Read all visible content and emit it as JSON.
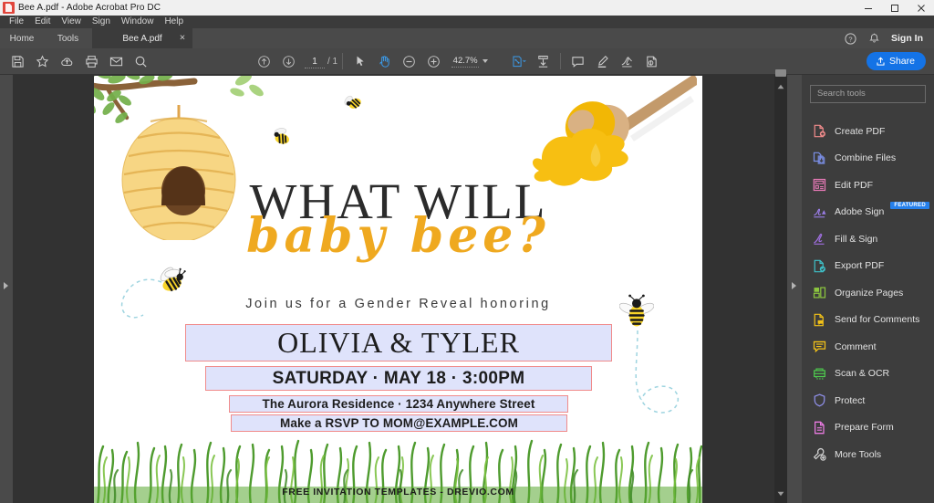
{
  "window": {
    "title": "Bee A.pdf - Adobe Acrobat Pro DC",
    "app_icon": "pdf-file-icon",
    "minimize": "minimize-icon",
    "maximize": "maximize-icon",
    "close": "close-icon"
  },
  "menubar": {
    "items": [
      {
        "label": "File"
      },
      {
        "label": "Edit"
      },
      {
        "label": "View"
      },
      {
        "label": "Sign"
      },
      {
        "label": "Window"
      },
      {
        "label": "Help"
      }
    ]
  },
  "tabs": {
    "home": "Home",
    "tools": "Tools",
    "document": "Bee A.pdf",
    "close_glyph": "×"
  },
  "account": {
    "help_icon": "help-circle-icon",
    "bell_icon": "bell-icon",
    "sign_in": "Sign In"
  },
  "toolbar": {
    "left_tools": [
      {
        "name": "save-icon",
        "title": "Save"
      },
      {
        "name": "star-icon",
        "title": "Add to favorites"
      },
      {
        "name": "cloud-upload-icon",
        "title": "Save to cloud"
      },
      {
        "name": "print-icon",
        "title": "Print file"
      },
      {
        "name": "email-icon",
        "title": "Email file"
      },
      {
        "name": "search-icon",
        "title": "Find"
      }
    ],
    "page_up_icon": "page-up-icon",
    "page_down_icon": "page-down-icon",
    "page_current": "1",
    "page_total": "/ 1",
    "select_icon": "select-cursor-icon",
    "hand_icon": "hand-tool-icon",
    "zoom_out_icon": "zoom-out-icon",
    "zoom_in_icon": "zoom-in-icon",
    "zoom_level": "42.7%",
    "right_tools": [
      {
        "name": "page-thumbnails-icon",
        "title": "Page display"
      },
      {
        "name": "fit-page-icon",
        "title": "Fit page"
      },
      {
        "name": "comment-icon",
        "title": "Add comment"
      },
      {
        "name": "highlight-icon",
        "title": "Highlight text"
      },
      {
        "name": "signature-icon",
        "title": "Sign"
      },
      {
        "name": "stamp-icon",
        "title": "Stamp"
      }
    ],
    "share_label": "Share",
    "share_icon": "share-upload-icon",
    "share_color": "#1473e6"
  },
  "rails": {
    "left_expand_icon": "expand-left-panel-icon",
    "right_expand_icon": "expand-right-panel-icon"
  },
  "scrollbar": {
    "up_icon": "scroll-up-icon",
    "down_icon": "scroll-down-icon"
  },
  "document": {
    "headline_top": "WHAT WILL",
    "headline_script": "baby bee?",
    "intro_line": "Join us for a Gender Reveal honoring",
    "fields": [
      {
        "name": "names-field",
        "value": "OLIVIA & TYLER"
      },
      {
        "name": "date-field",
        "value": "SATURDAY · MAY 18 ·  3:00PM"
      },
      {
        "name": "address-field",
        "value": "The Aurora Residence · 1234 Anywhere Street"
      },
      {
        "name": "rsvp-field",
        "value": "Make a RSVP TO MOM@EXAMPLE.COM"
      }
    ],
    "footer_credit": "FREE INVITATION TEMPLATES - DREVIO.COM",
    "field_fill": "#dfe3fb",
    "field_border": "#f08b8b",
    "accent_yellow": "#efa920",
    "artwork": [
      "tree-branch-icon",
      "beehive-icon",
      "honey-dipper-icon",
      "bee-icon",
      "grass-icon"
    ]
  },
  "tools_panel": {
    "search_placeholder": "Search tools",
    "items": [
      {
        "label": "Create PDF",
        "icon": "create-pdf-icon",
        "color": "#f08b8b",
        "badge": ""
      },
      {
        "label": "Combine Files",
        "icon": "combine-files-icon",
        "color": "#7b8fe8",
        "badge": ""
      },
      {
        "label": "Edit PDF",
        "icon": "edit-pdf-icon",
        "color": "#e87ab8",
        "badge": ""
      },
      {
        "label": "Adobe Sign",
        "icon": "adobe-sign-icon",
        "color": "#9b7de8",
        "badge": "FEATURED"
      },
      {
        "label": "Fill & Sign",
        "icon": "fill-and-sign-icon",
        "color": "#a06fe0",
        "badge": ""
      },
      {
        "label": "Export PDF",
        "icon": "export-pdf-icon",
        "color": "#3fc0c8",
        "badge": ""
      },
      {
        "label": "Organize Pages",
        "icon": "organize-pages-icon",
        "color": "#8cc63f",
        "badge": ""
      },
      {
        "label": "Send for Comments",
        "icon": "send-for-comments-icon",
        "color": "#f3c218",
        "badge": ""
      },
      {
        "label": "Comment",
        "icon": "comment-bubble-icon",
        "color": "#f3c218",
        "badge": ""
      },
      {
        "label": "Scan & OCR",
        "icon": "scan-ocr-icon",
        "color": "#4ecb4e",
        "badge": ""
      },
      {
        "label": "Protect",
        "icon": "shield-icon",
        "color": "#8f8fe8",
        "badge": ""
      },
      {
        "label": "Prepare Form",
        "icon": "prepare-form-icon",
        "color": "#e87ae0",
        "badge": ""
      },
      {
        "label": "More Tools",
        "icon": "more-tools-icon",
        "color": "#d6d6d6",
        "badge": ""
      }
    ]
  }
}
